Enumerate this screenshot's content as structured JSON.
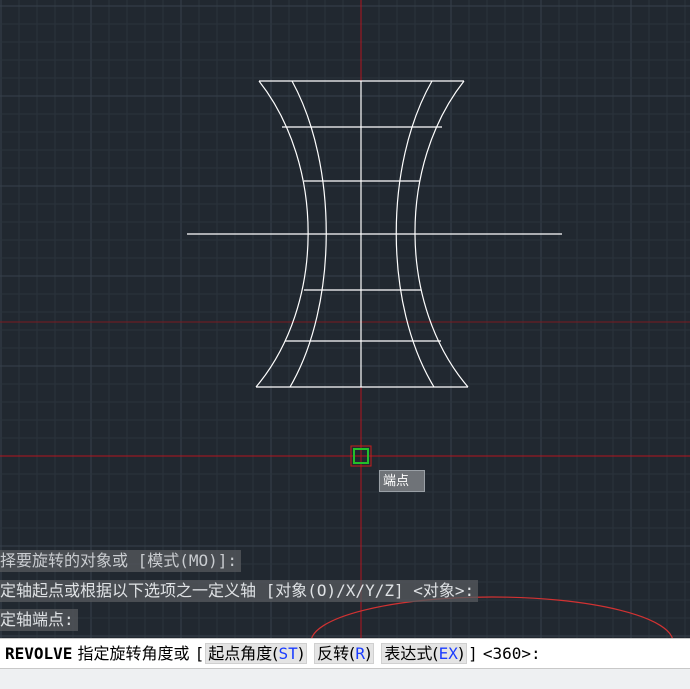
{
  "tooltip": {
    "label": "端点"
  },
  "history": [
    "择要旋转的对象或 [模式(MO)]:",
    "定轴起点或根据以下选项之一定义轴 [对象(O)/X/Y/Z] <对象>:",
    "定轴端点:"
  ],
  "command_line": {
    "command": "REVOLVE",
    "prompt": "指定旋转角度或",
    "bracket_open": "[",
    "options": [
      {
        "label": "起点角度(",
        "key": "ST",
        "close": ")"
      },
      {
        "label": "反转(",
        "key": "R",
        "close": ")"
      },
      {
        "label": "表达式(",
        "key": "EX",
        "close": ")"
      }
    ],
    "bracket_close": "]",
    "default": "<360>:"
  },
  "colors": {
    "background": "#212830",
    "grid_minor": "#2b333c",
    "grid_major": "#36404b",
    "crosshair": "#b4141e",
    "drawing": "#ffffff",
    "snap_marker": "#22c02a",
    "annotation": "#d23232"
  },
  "icons": {
    "snap_marker": "endpoint-snap-icon"
  }
}
